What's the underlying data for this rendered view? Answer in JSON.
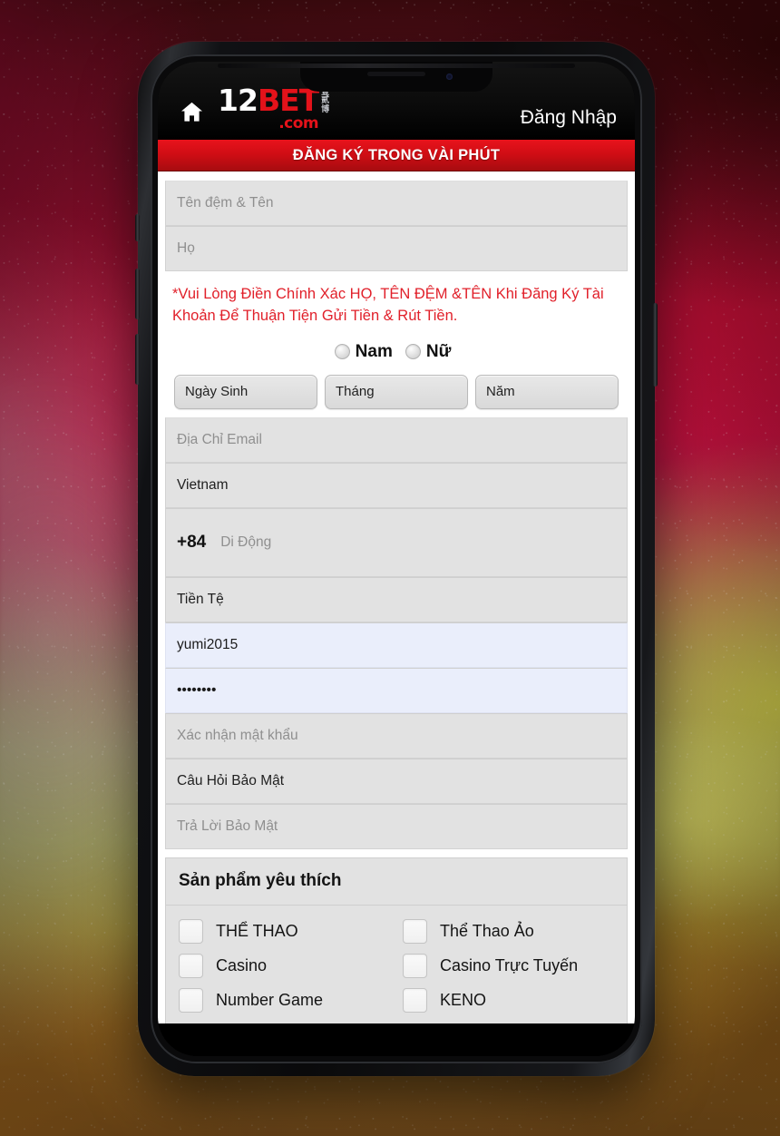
{
  "theme": {
    "brand_red": "#cf0d14",
    "logo_red": "#e4121a",
    "notice_red": "#e1202a",
    "field_bg": "#e2e2e2",
    "filled_field_bg": "#eaeefb",
    "topbar_bg": "#000000"
  },
  "topbar": {
    "home_icon": "home-icon",
    "logo": {
      "part1": "12",
      "part2": "BET",
      "part3": ".com",
      "cn_line1": "壹",
      "cn_line2": "贰",
      "cn_line3": "博"
    },
    "login_label": "Đăng Nhập"
  },
  "banner": {
    "title": "ĐĂNG KÝ TRONG VÀI PHÚT"
  },
  "form": {
    "name_fields": [
      {
        "name": "first-middle-name",
        "placeholder": "Tên đệm & Tên",
        "value": "",
        "filled": false
      },
      {
        "name": "last-name",
        "placeholder": "Họ",
        "value": "",
        "filled": false
      }
    ],
    "notice": "*Vui Lòng Điền Chính Xác HỌ, TÊN ĐỆM &TÊN Khi Đăng Ký Tài Khoản Để Thuận Tiện Gửi Tiền & Rút Tiền.",
    "gender": {
      "male_label": "Nam",
      "female_label": "Nữ",
      "male_selected": false,
      "female_selected": false
    },
    "dob": [
      {
        "name": "dob-day-select",
        "value": "Ngày Sinh"
      },
      {
        "name": "dob-month-select",
        "value": "Tháng"
      },
      {
        "name": "dob-year-select",
        "value": "Năm"
      }
    ],
    "contact_fields": [
      {
        "name": "email-field",
        "placeholder": "Địa Chỉ Email",
        "value": "",
        "filled": false
      },
      {
        "name": "country-select",
        "placeholder": "Vietnam",
        "value": "Vietnam",
        "filled": false
      }
    ],
    "phone": {
      "country_code": "+84",
      "placeholder": "Di Động",
      "value": ""
    },
    "currency_field": {
      "name": "currency-select",
      "placeholder": "Tiền Tệ",
      "value": "Tiền Tệ",
      "filled": false
    },
    "account_fields": [
      {
        "name": "username-field",
        "placeholder": "",
        "value": "yumi2015",
        "filled": true
      },
      {
        "name": "password-field",
        "placeholder": "",
        "value": "••••••••",
        "filled": true
      },
      {
        "name": "confirm-password-field",
        "placeholder": "Xác nhận mật khẩu",
        "value": "",
        "filled": false
      },
      {
        "name": "security-question-select",
        "placeholder": "Câu Hỏi Bảo Mật",
        "value": "Câu Hỏi Bảo Mật",
        "filled": false
      },
      {
        "name": "security-answer-field",
        "placeholder": "Trả Lời Bảo Mật",
        "value": "",
        "filled": false
      }
    ]
  },
  "products": {
    "heading": "Sản phẩm yêu thích",
    "items": [
      {
        "label": "THỂ THAO",
        "checked": false
      },
      {
        "label": "Thể Thao Ảo",
        "checked": false
      },
      {
        "label": "Casino",
        "checked": false
      },
      {
        "label": "Casino Trực Tuyến",
        "checked": false
      },
      {
        "label": "Number Game",
        "checked": false
      },
      {
        "label": "KENO",
        "checked": false
      }
    ]
  }
}
